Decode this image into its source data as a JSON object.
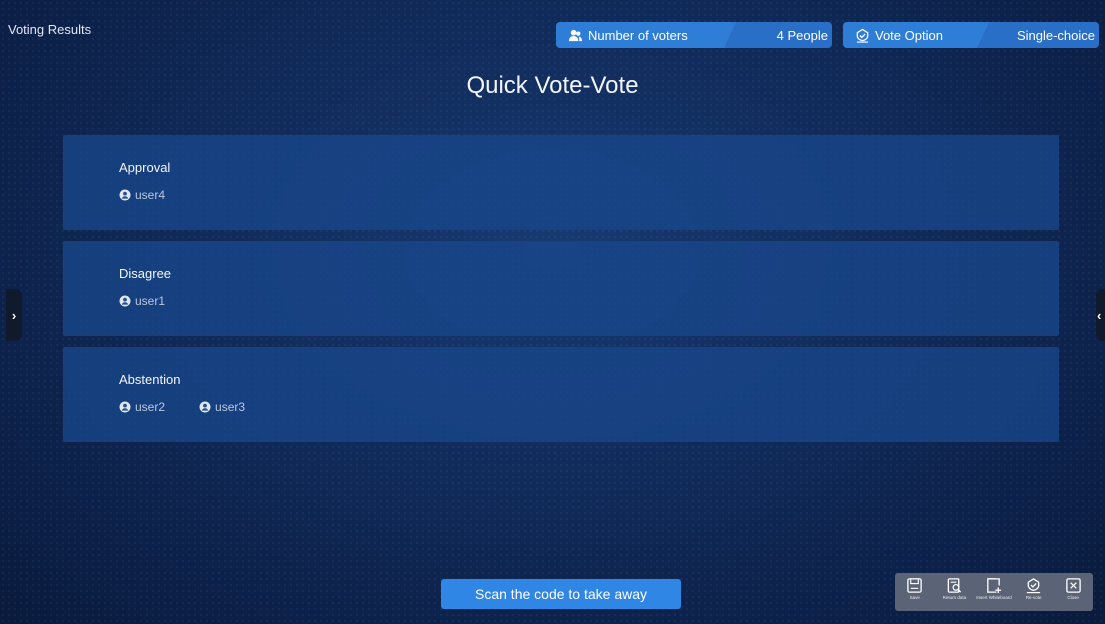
{
  "header": {
    "title": "Voting Results",
    "voters_label": "Number of voters",
    "voters_value": "4 People",
    "option_label": "Vote Option",
    "option_value": "Single-choice",
    "voters_icon": "users-icon",
    "option_icon": "check-badge-icon"
  },
  "main": {
    "title": "Quick Vote-Vote"
  },
  "options": [
    {
      "name": "Approval",
      "voters": [
        "user4"
      ]
    },
    {
      "name": "Disagree",
      "voters": [
        "user1"
      ]
    },
    {
      "name": "Abstention",
      "voters": [
        "user2",
        "user3"
      ]
    }
  ],
  "footer": {
    "scan_label": "Scan the code to take away"
  },
  "toolbar": {
    "items": [
      {
        "label": "Save",
        "icon": "save-icon"
      },
      {
        "label": "Return data",
        "icon": "return-data-icon"
      },
      {
        "label": "Insert Whiteboard",
        "icon": "insert-whiteboard-icon"
      },
      {
        "label": "Re-vote",
        "icon": "re-vote-icon"
      },
      {
        "label": "Close",
        "icon": "close-icon"
      }
    ]
  },
  "side_tabs": {
    "left_glyph": "›",
    "right_glyph": "‹"
  },
  "colors": {
    "accent": "#2f86e4",
    "card": "#18468a",
    "background": "#112c5c"
  }
}
